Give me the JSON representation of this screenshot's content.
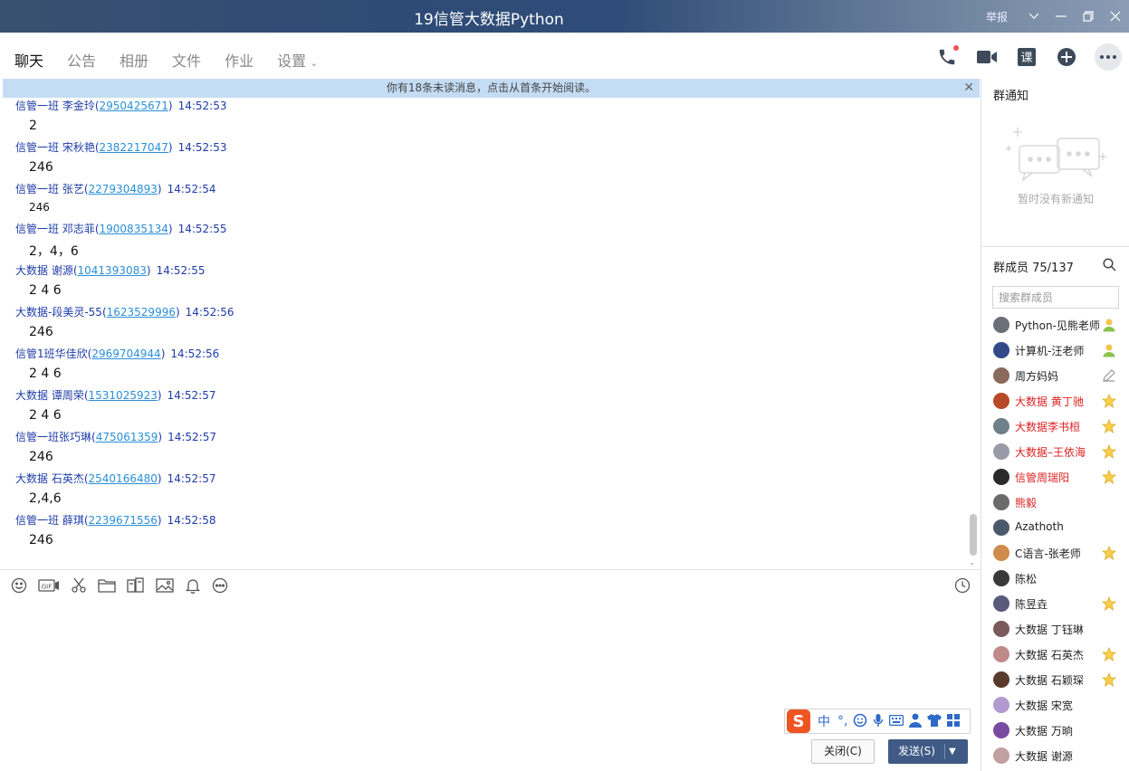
{
  "window": {
    "title": "19信管大数据Python",
    "report_label": "举报"
  },
  "tabs": [
    {
      "label": "聊天"
    },
    {
      "label": "公告"
    },
    {
      "label": "相册"
    },
    {
      "label": "文件"
    },
    {
      "label": "作业"
    },
    {
      "label": "设置"
    }
  ],
  "notice": {
    "text": "你有18条未读消息，点击从首条开始阅读。"
  },
  "messages": [
    {
      "sender": "信管一班 李金玲",
      "qq": "2950425671",
      "time": "14:52:53",
      "text": "2"
    },
    {
      "sender": "信管一班 宋秋艳",
      "qq": "2382217047",
      "time": "14:52:53",
      "text": "246"
    },
    {
      "sender": "信管一班 张艺",
      "qq": "2279304893",
      "time": "14:52:54",
      "text": "246"
    },
    {
      "sender": "信管一班 邓志菲",
      "qq": "1900835134",
      "time": "14:52:55",
      "text": "2，4，6"
    },
    {
      "sender": "大数据 谢源",
      "qq": "1041393083",
      "time": "14:52:55",
      "text": "2 4 6"
    },
    {
      "sender": "大数据-段美灵-55",
      "qq": "1623529996",
      "time": "14:52:56",
      "text": "246"
    },
    {
      "sender": "信管1班华佳欣",
      "qq": "2969704944",
      "time": "14:52:56",
      "text": "2 4 6"
    },
    {
      "sender": "大数据 谭周荣",
      "qq": "1531025923",
      "time": "14:52:57",
      "text": "2 4 6"
    },
    {
      "sender": "信管一班张巧琳",
      "qq": "475061359",
      "time": "14:52:57",
      "text": "246"
    },
    {
      "sender": "大数据 石英杰",
      "qq": "2540166480",
      "time": "14:52:57",
      "text": "2,4,6"
    },
    {
      "sender": "信管一班 薛琪",
      "qq": "2239671556",
      "time": "14:52:58",
      "text": "246"
    }
  ],
  "ime": {
    "logo": "S",
    "mode": "中",
    "punct": "°,"
  },
  "buttons": {
    "close": "关闭(C)",
    "send": "发送(S)"
  },
  "group_notice": {
    "title": "群通知",
    "empty_text": "暂时没有新通知"
  },
  "members": {
    "title": "群成员 75/137",
    "search_placeholder": "搜索群成员",
    "list": [
      {
        "name": "Python-见熊老师",
        "badge": "admin-icon",
        "red": false
      },
      {
        "name": "计算机-汪老师",
        "badge": "admin-icon",
        "red": false
      },
      {
        "name": "周方妈妈",
        "badge": "edit-icon",
        "red": false
      },
      {
        "name": "大数据  黄丁驰",
        "badge": "star-icon",
        "red": true
      },
      {
        "name": "大数据李书桓",
        "badge": "star-icon",
        "red": true
      },
      {
        "name": "大数据–王依海",
        "badge": "star-icon",
        "red": true
      },
      {
        "name": "信管周瑞阳",
        "badge": "star-icon",
        "red": true
      },
      {
        "name": "熊毅",
        "badge": "",
        "red": true
      },
      {
        "name": "Azathoth",
        "badge": "",
        "red": false
      },
      {
        "name": "C语言-张老师",
        "badge": "star-icon",
        "red": false
      },
      {
        "name": "陈松",
        "badge": "",
        "red": false
      },
      {
        "name": "陈昱垚",
        "badge": "star-icon",
        "red": false
      },
      {
        "name": "大数据 丁钰琳",
        "badge": "",
        "red": false
      },
      {
        "name": "大数据 石英杰",
        "badge": "star-icon",
        "red": false
      },
      {
        "name": "大数据 石颖琛",
        "badge": "star-icon",
        "red": false
      },
      {
        "name": "大数据 宋宽",
        "badge": "",
        "red": false
      },
      {
        "name": "大数据 万晌",
        "badge": "",
        "red": false
      },
      {
        "name": "大数据 谢源",
        "badge": "",
        "red": false
      }
    ]
  }
}
